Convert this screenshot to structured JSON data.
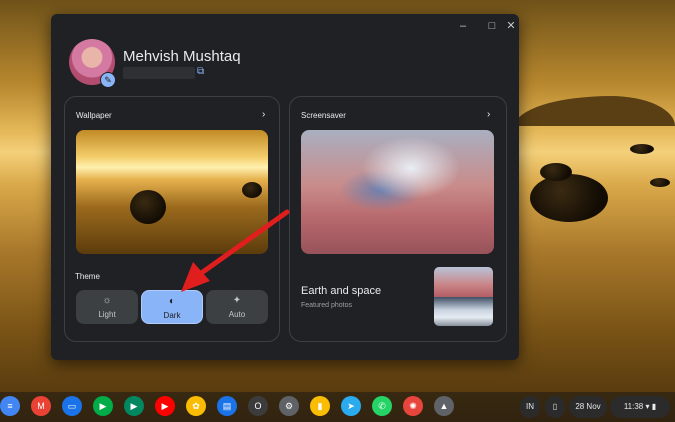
{
  "window": {
    "controls": {
      "minimize": "–",
      "maximize": "□",
      "close": "✕"
    },
    "profile": {
      "name": "Mehvish Mushtaq",
      "edit_icon": "pencil-icon",
      "external_link_icon": "open-in-new-icon"
    },
    "wallpaper_card": {
      "title": "Wallpaper",
      "chevron": "›"
    },
    "theme": {
      "label": "Theme",
      "options": [
        {
          "label": "Light",
          "icon": "☼",
          "selected": false
        },
        {
          "label": "Dark",
          "icon": "◐",
          "selected": true
        },
        {
          "label": "Auto",
          "icon": "✦",
          "selected": false
        }
      ]
    },
    "screensaver_card": {
      "title": "Screensaver",
      "chevron": "›",
      "album_name": "Earth and space",
      "album_subtitle": "Featured photos"
    }
  },
  "shelf": {
    "apps": [
      {
        "icon": "docs-icon",
        "glyph": "≡",
        "color": "#4285f4"
      },
      {
        "icon": "gmail-icon",
        "glyph": "M",
        "color": "#ea4335"
      },
      {
        "icon": "files-icon",
        "glyph": "▭",
        "color": "#1a73e8"
      },
      {
        "icon": "meet-icon",
        "glyph": "▶",
        "color": "#00ac47"
      },
      {
        "icon": "play-store-icon",
        "glyph": "▶",
        "color": "#01875f"
      },
      {
        "icon": "youtube-icon",
        "glyph": "▶",
        "color": "#ff0000"
      },
      {
        "icon": "photos-icon",
        "glyph": "✿",
        "color": "#fbbc04"
      },
      {
        "icon": "messages-icon",
        "glyph": "▤",
        "color": "#1a73e8"
      },
      {
        "icon": "opera-icon",
        "glyph": "O",
        "color": "#3c3c3c"
      },
      {
        "icon": "settings-icon",
        "glyph": "⚙",
        "color": "#5f6368"
      },
      {
        "icon": "keep-icon",
        "glyph": "▮",
        "color": "#fbbc04"
      },
      {
        "icon": "telegram-icon",
        "glyph": "➤",
        "color": "#2aabee"
      },
      {
        "icon": "whatsapp-icon",
        "glyph": "✆",
        "color": "#25d366"
      },
      {
        "icon": "paint-icon",
        "glyph": "✺",
        "color": "#e8453c"
      },
      {
        "icon": "app-icon",
        "glyph": "▲",
        "color": "#5f6368"
      }
    ],
    "language": "IN",
    "date": "28 Nov",
    "time": "11:38",
    "accent": "#8ab4f8"
  }
}
